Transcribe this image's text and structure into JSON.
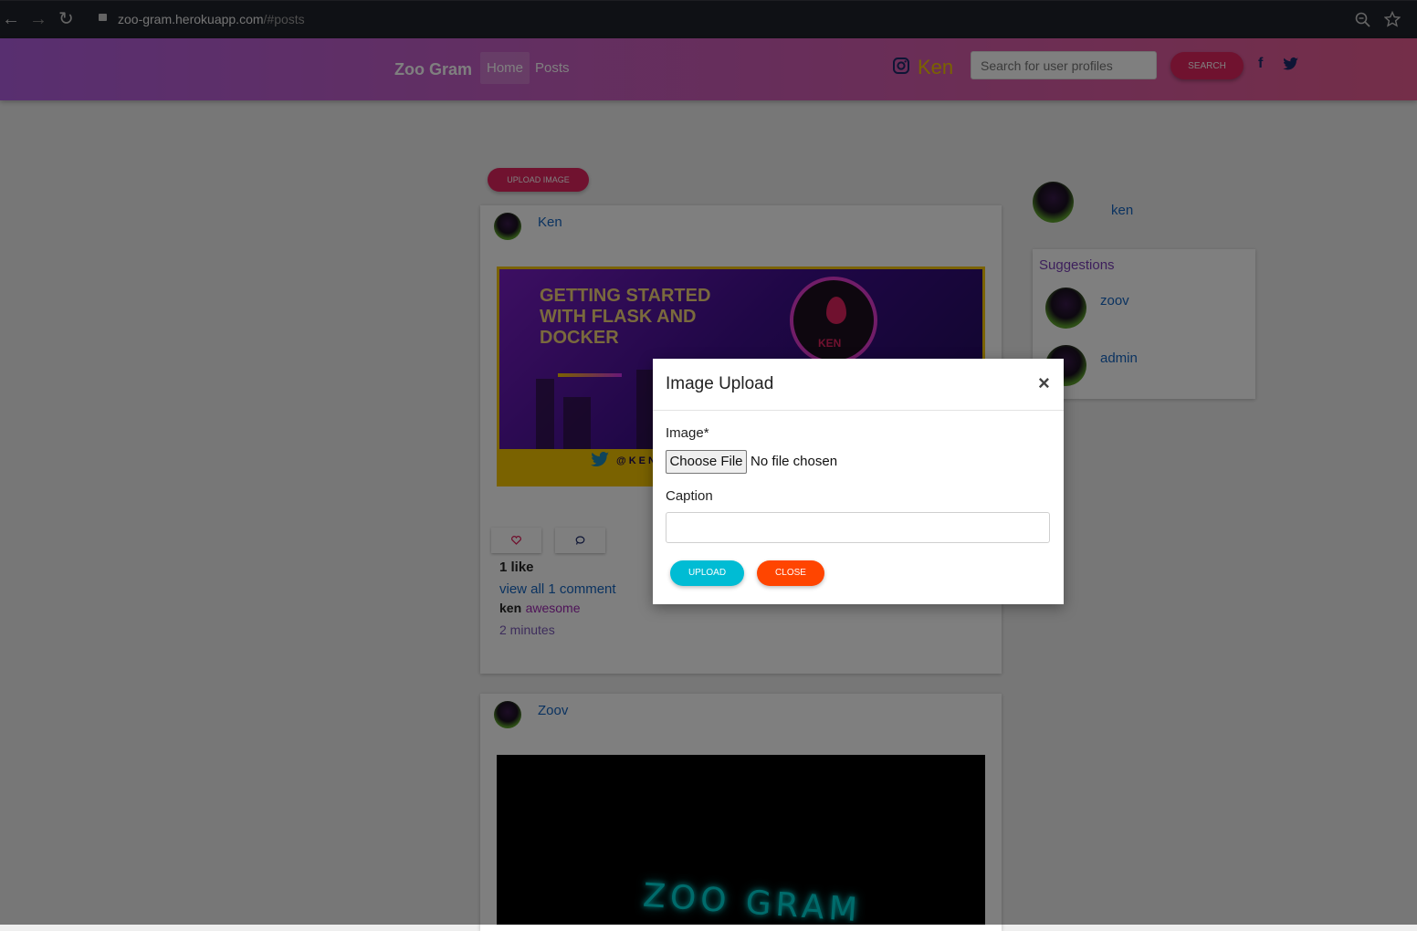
{
  "browser": {
    "url_host": "zoo-gram.herokuapp.com",
    "url_path": "/#posts",
    "icons": [
      "back-arrow-icon",
      "forward-arrow-icon",
      "reload-icon",
      "lock-icon",
      "zoom-icon",
      "star-icon"
    ]
  },
  "navbar": {
    "brand": "Zoo Gram",
    "links": [
      {
        "label": "Home",
        "active": true
      },
      {
        "label": "Posts",
        "active": false
      }
    ],
    "current_user": "Ken",
    "search_placeholder": "Search for user profiles",
    "search_button": "Search",
    "social": {
      "facebook": "f",
      "twitter": "twitter-icon"
    },
    "gradient": [
      "#b15fe0",
      "#e85c92"
    ]
  },
  "main": {
    "upload_button": "Upload Image",
    "posts": [
      {
        "author": "Ken",
        "image": {
          "headline": "GETTING STARTED WITH FLASK AND DOCKER",
          "logo_text": "KEN",
          "handle": "@KEN_"
        },
        "like_icon": "heart-icon",
        "comment_icon": "comment-icon",
        "likes": "1 like",
        "view_comments": "view all 1 comment",
        "comment": {
          "user": "ken",
          "text": "awesome"
        },
        "timestamp": "2 minutes"
      },
      {
        "author": "Zoov",
        "image": {
          "neon_text": "ZOO GRAM"
        }
      }
    ]
  },
  "sidebar": {
    "user": "ken",
    "suggestions_title": "Suggestions",
    "suggestions": [
      "zoov",
      "admin"
    ]
  },
  "modal": {
    "title": "Image Upload",
    "close_glyph": "×",
    "image_label": "Image*",
    "file_button": "Choose File",
    "file_status": "No file chosen",
    "caption_label": "Caption",
    "caption_value": "",
    "upload_button": "Upload",
    "close_button": "Close",
    "colors": {
      "upload": "#00bcd4",
      "close": "#ff4500"
    }
  }
}
